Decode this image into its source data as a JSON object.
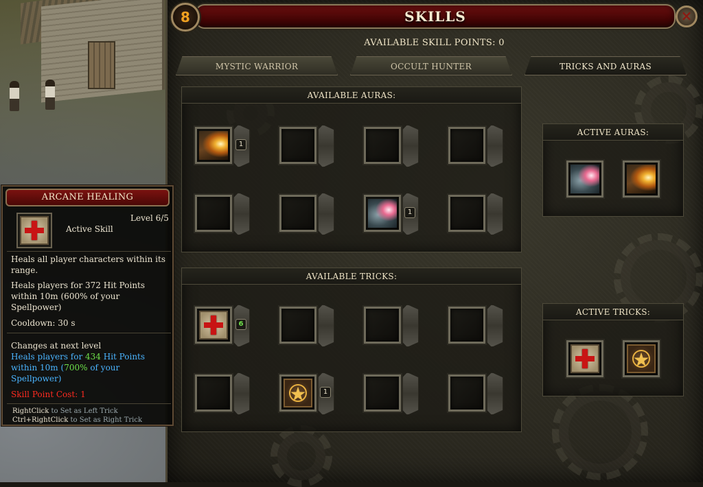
{
  "window": {
    "title": "SKILLS",
    "level": "8",
    "close_label": "×",
    "skill_points_label": "AVAILABLE SKILL POINTS: 0"
  },
  "tabs": [
    {
      "label": "MYSTIC WARRIOR",
      "active": false
    },
    {
      "label": "OCCULT HUNTER",
      "active": false
    },
    {
      "label": "TRICKS AND AURAS",
      "active": true
    }
  ],
  "available_auras": {
    "header": "AVAILABLE AURAS:",
    "slots": [
      {
        "icon": "flame-aura-icon",
        "rank": "1"
      },
      {
        "icon": null,
        "rank": null
      },
      {
        "icon": null,
        "rank": null
      },
      {
        "icon": null,
        "rank": null
      },
      {
        "icon": null,
        "rank": null
      },
      {
        "icon": null,
        "rank": null
      },
      {
        "icon": "gunshot-aura-icon",
        "rank": "1"
      },
      {
        "icon": null,
        "rank": null
      }
    ]
  },
  "available_tricks": {
    "header": "AVAILABLE TRICKS:",
    "slots": [
      {
        "icon": "arcane-healing-icon",
        "rank": "6"
      },
      {
        "icon": null,
        "rank": null
      },
      {
        "icon": null,
        "rank": null
      },
      {
        "icon": null,
        "rank": null
      },
      {
        "icon": null,
        "rank": null
      },
      {
        "icon": "pentagram-trick-icon",
        "rank": "1"
      },
      {
        "icon": null,
        "rank": null
      },
      {
        "icon": null,
        "rank": null
      }
    ]
  },
  "active_auras": {
    "header": "ACTIVE AURAS:",
    "icons": [
      "gunshot-aura-icon",
      "flame-aura-icon"
    ]
  },
  "active_tricks": {
    "header": "ACTIVE TRICKS:",
    "icons": [
      "arcane-healing-icon",
      "pentagram-trick-icon"
    ]
  },
  "tooltip": {
    "title": "ARCANE HEALING",
    "icon": "arcane-healing-icon",
    "level": "Level 6/5",
    "type": "Active Skill",
    "desc1_line1": "Heals all player characters within its",
    "desc1_line2": "range.",
    "desc2_line1": "Heals players for 372 Hit Points",
    "desc2_line2": "within 10m (600% of your",
    "desc2_line3": "Spellpower)",
    "cooldown": "Cooldown: 30 s",
    "next_header": "Changes at next level",
    "next_l1_a": "Heals players for ",
    "next_l1_b": "434",
    "next_l1_c": " Hit Points",
    "next_l2_a": "within 10m (",
    "next_l2_b": "700%",
    "next_l2_c": " of your",
    "next_l3": "Spellpower)",
    "cost": "Skill Point Cost: 1",
    "hint1_key": "RightClick",
    "hint1_rest": " to Set as Left Trick",
    "hint2_key": "Ctrl+RightClick",
    "hint2_rest": " to Set as Right Trick"
  }
}
